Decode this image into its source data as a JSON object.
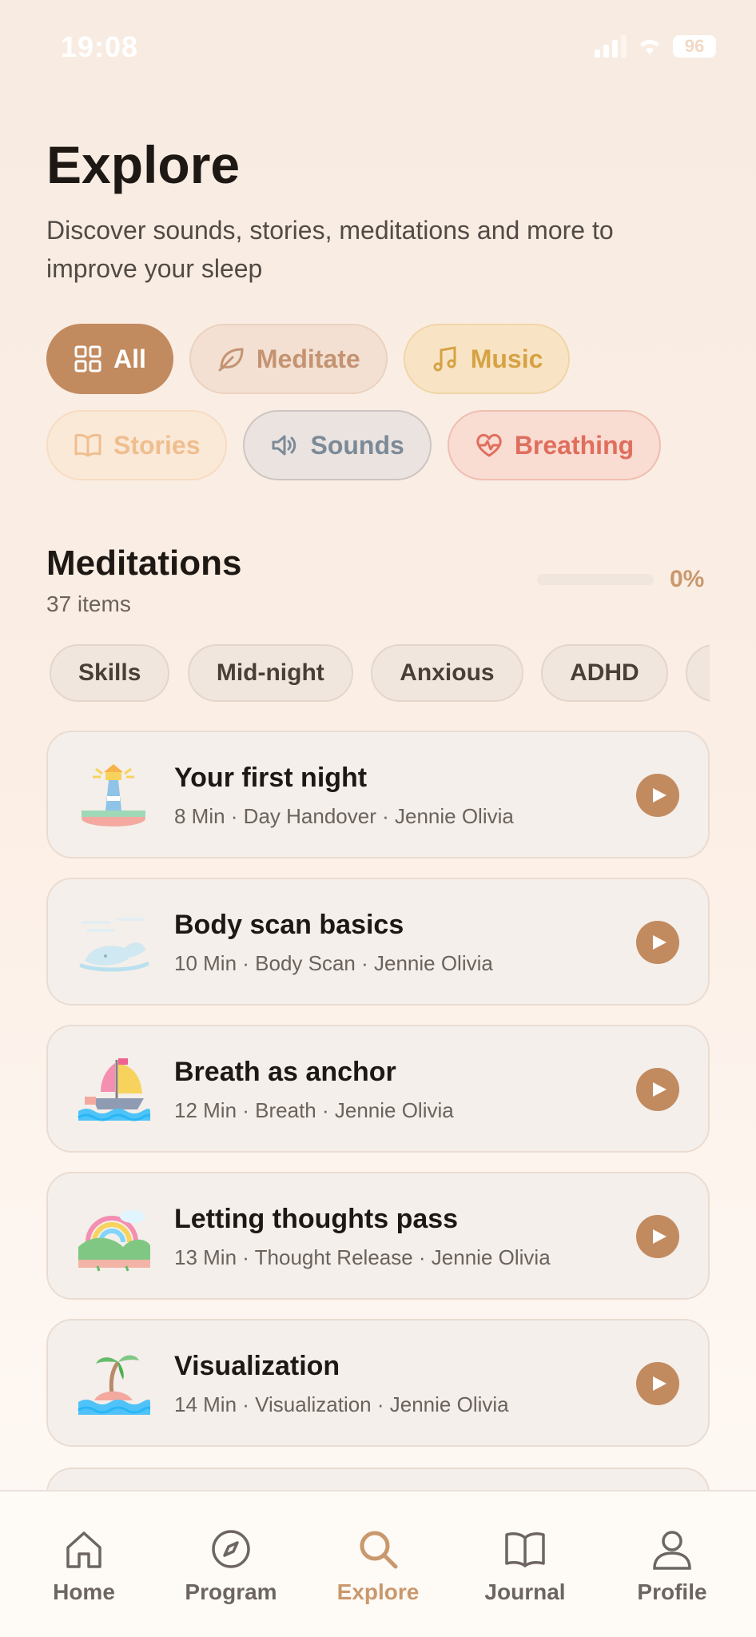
{
  "status_bar": {
    "time": "19:08",
    "battery": "96"
  },
  "header": {
    "title": "Explore",
    "subtitle": "Discover sounds, stories, meditations and more to improve your sleep"
  },
  "filters": {
    "all": "All",
    "meditate": "Meditate",
    "music": "Music",
    "stories": "Stories",
    "sounds": "Sounds",
    "breathing": "Breathing"
  },
  "section": {
    "title": "Meditations",
    "count": "37 items",
    "progress_label": "0%",
    "progress_value": 0
  },
  "tags": [
    "Skills",
    "Mid-night",
    "Anxious",
    "ADHD"
  ],
  "items": [
    {
      "title": "Your first night",
      "meta": "8 Min · Day Handover · Jennie Olivia",
      "icon": "lighthouse-icon"
    },
    {
      "title": "Body scan basics",
      "meta": "10 Min · Body Scan · Jennie Olivia",
      "icon": "whale-icon"
    },
    {
      "title": "Breath as anchor",
      "meta": "12 Min · Breath · Jennie Olivia",
      "icon": "boat-icon"
    },
    {
      "title": "Letting thoughts pass",
      "meta": "13 Min · Thought Release · Jennie Olivia",
      "icon": "rainbow-hills-icon"
    },
    {
      "title": "Visualization",
      "meta": "14 Min · Visualization · Jennie Olivia",
      "icon": "island-icon"
    }
  ],
  "tabs": {
    "home": "Home",
    "program": "Program",
    "explore": "Explore",
    "journal": "Journal",
    "profile": "Profile"
  },
  "colors": {
    "accent": "#c28a5f",
    "background": "#fbeee4",
    "active_tab": "#c9986d"
  }
}
